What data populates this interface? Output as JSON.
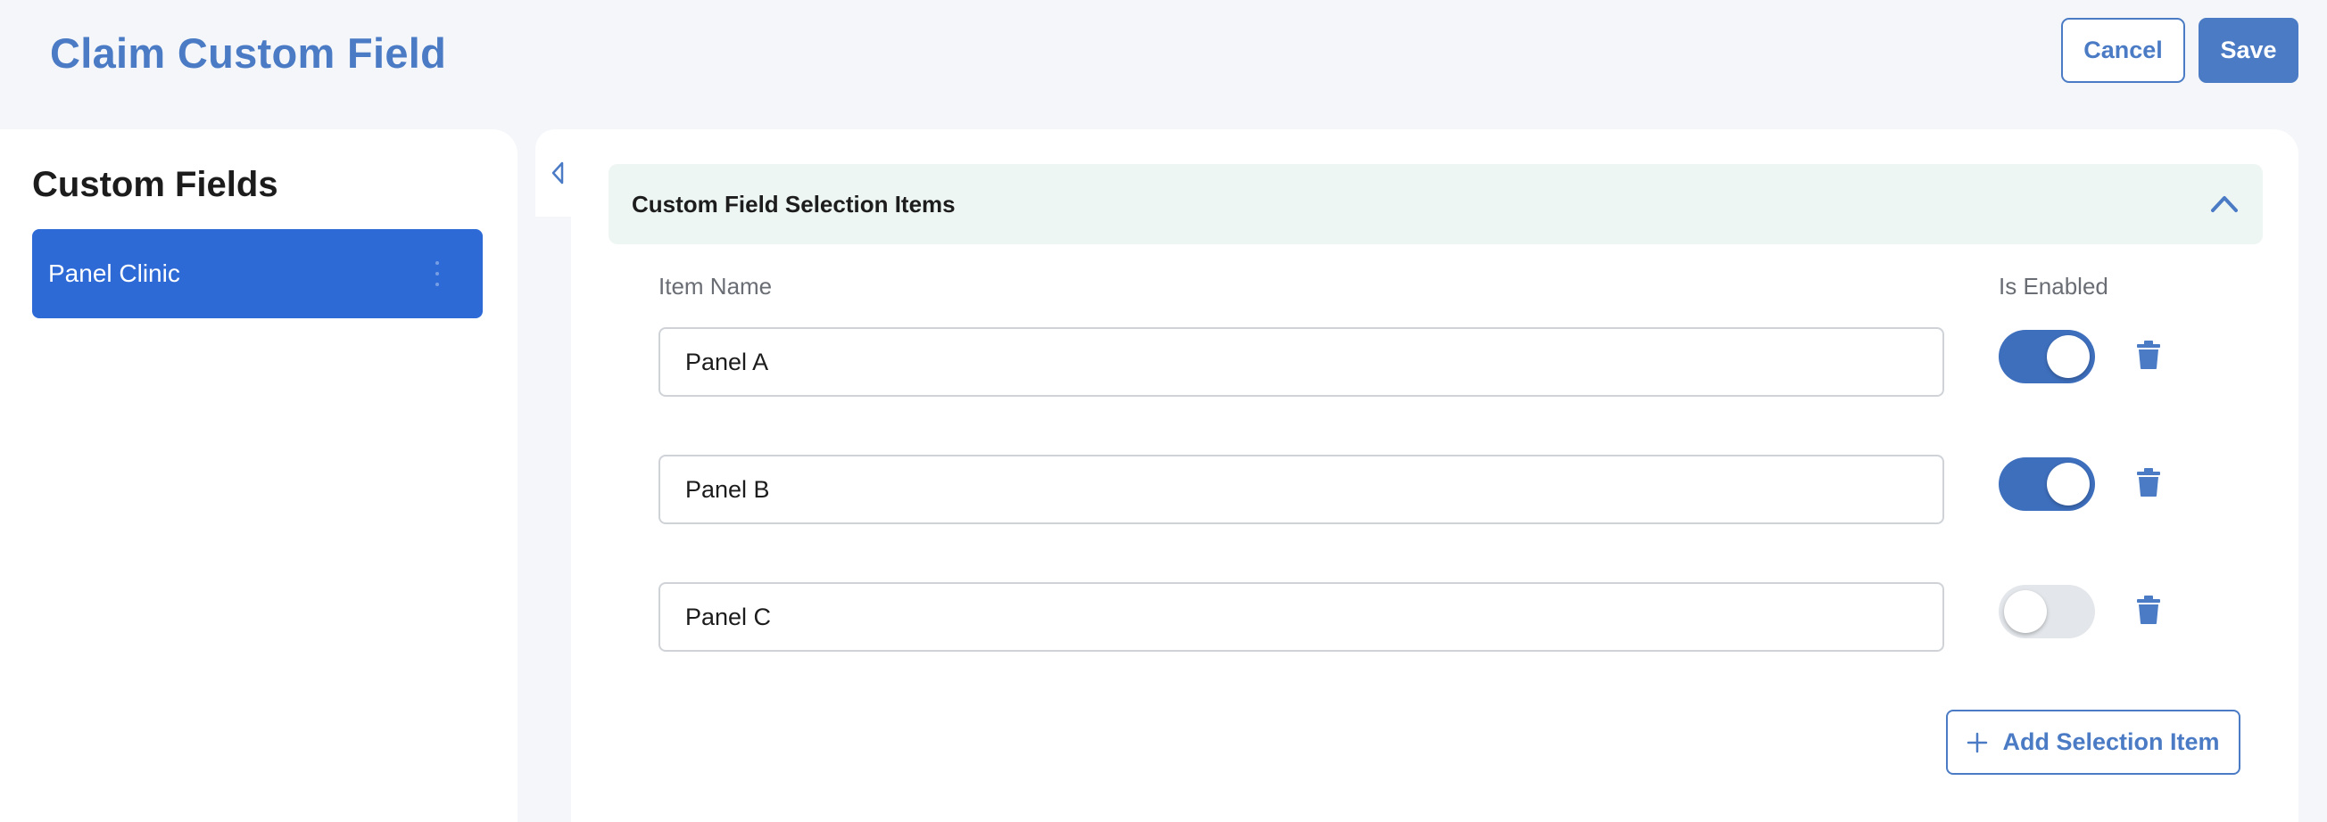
{
  "header": {
    "title": "Claim Custom Field",
    "cancel_label": "Cancel",
    "save_label": "Save"
  },
  "sidebar": {
    "title": "Custom Fields",
    "items": [
      {
        "label": "Panel Clinic",
        "selected": true
      }
    ]
  },
  "section": {
    "title": "Custom Field Selection Items",
    "expanded": true,
    "columns": {
      "item_name": "Item Name",
      "is_enabled": "Is Enabled"
    },
    "rows": [
      {
        "name": "Panel A",
        "enabled": true
      },
      {
        "name": "Panel B",
        "enabled": true
      },
      {
        "name": "Panel C",
        "enabled": false
      }
    ],
    "add_label": "Add Selection Item"
  },
  "icons": {
    "collapse": "caret-left-icon",
    "chevron": "chevron-up-icon",
    "delete": "trash-icon",
    "add": "plus-icon",
    "kebab": "kebab-menu-icon"
  },
  "colors": {
    "accent": "#4a7bc4",
    "selected_item": "#2e6ad6",
    "toggle_on": "#3e6fbd",
    "section_header_bg": "#eef6f4"
  }
}
